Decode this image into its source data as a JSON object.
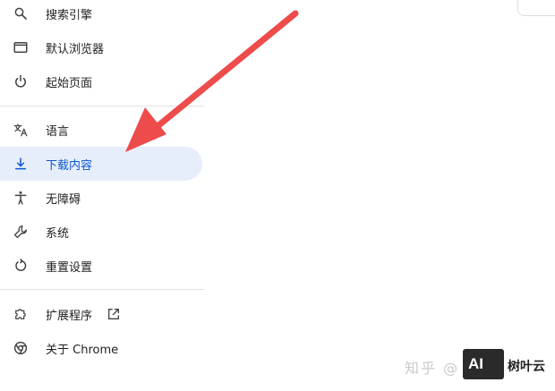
{
  "menu": {
    "items": [
      {
        "label": "搜索引擎",
        "icon": "search-icon"
      },
      {
        "label": "默认浏览器",
        "icon": "browser-window-icon"
      },
      {
        "label": "起始页面",
        "icon": "power-icon"
      },
      {
        "label": "语言",
        "icon": "translate-icon"
      },
      {
        "label": "下载内容",
        "icon": "download-icon",
        "active": true
      },
      {
        "label": "无障碍",
        "icon": "accessibility-icon"
      },
      {
        "label": "系统",
        "icon": "wrench-icon"
      },
      {
        "label": "重置设置",
        "icon": "reset-icon"
      },
      {
        "label": "扩展程序",
        "icon": "extension-icon"
      },
      {
        "label": "关于 Chrome",
        "icon": "chrome-icon"
      }
    ]
  },
  "colors": {
    "active_bg": "#e6eefb",
    "active_text": "#0b57d0",
    "arrow": "#ee4b4b"
  },
  "watermark": {
    "site": "知乎 @",
    "logo_text": "AI",
    "brand": "树叶云"
  }
}
